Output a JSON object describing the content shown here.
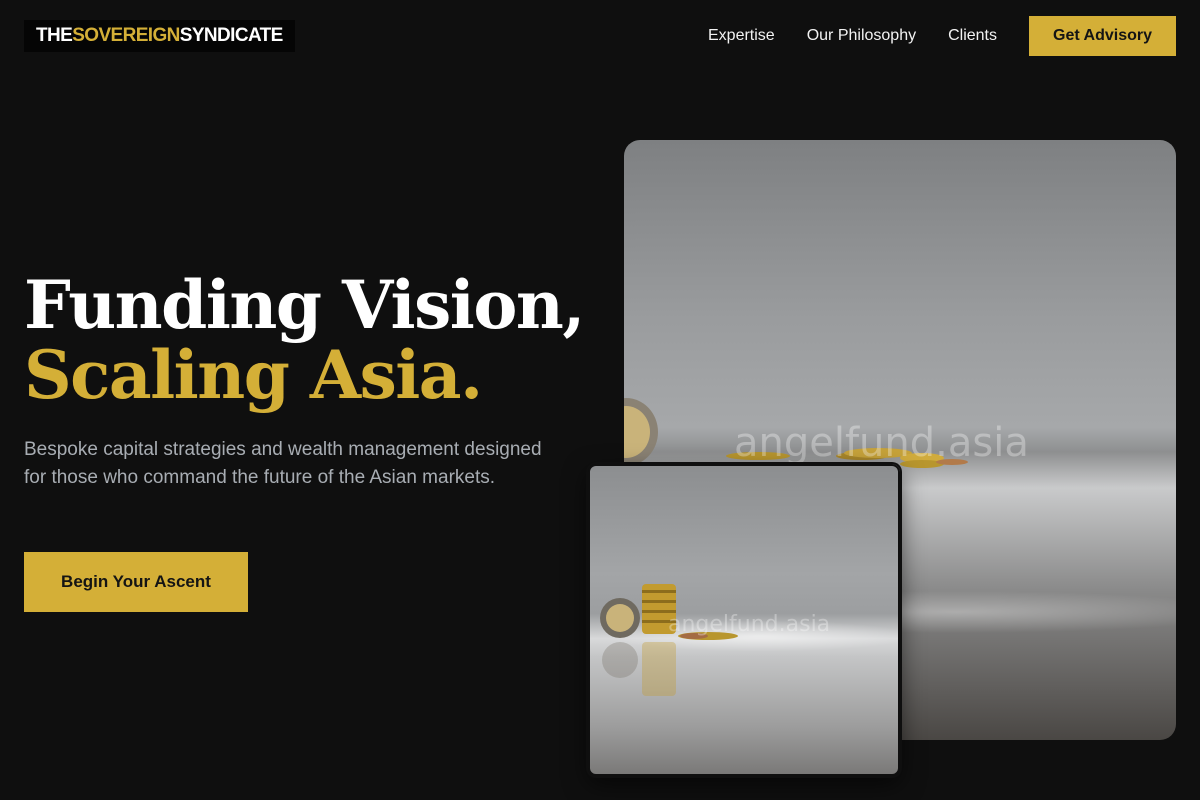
{
  "header": {
    "logo": {
      "part1": "THE ",
      "part2": "SOVEREIGN",
      "part3": " SYNDICATE"
    },
    "nav": [
      {
        "label": "Expertise"
      },
      {
        "label": "Our Philosophy"
      },
      {
        "label": "Clients"
      }
    ],
    "cta_label": "Get Advisory"
  },
  "hero": {
    "title_line1": "Funding Vision,",
    "title_line2": "Scaling Asia.",
    "description": "Bespoke capital strategies and wealth management designed for those who command the future of the Asian markets.",
    "cta_label": "Begin Your Ascent"
  },
  "images": {
    "large_watermark": "angelfund.asia",
    "small_watermark": "angelfund.asia"
  },
  "colors": {
    "background": "#0f0f0f",
    "accent_gold": "#d4af37",
    "text_white": "#ffffff",
    "text_muted": "#a8adb3"
  }
}
